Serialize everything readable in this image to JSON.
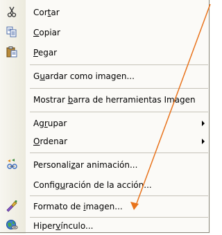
{
  "menu": {
    "items": [
      {
        "pre": "Cor",
        "u": "t",
        "post": "ar",
        "icon": "scissors-icon"
      },
      {
        "pre": "",
        "u": "C",
        "post": "opiar",
        "icon": "copy-icon"
      },
      {
        "pre": "",
        "u": "P",
        "post": "egar",
        "icon": "paste-icon"
      },
      {
        "pre": "G",
        "u": "u",
        "post": "ardar como imagen..."
      },
      {
        "pre": "Mostrar ",
        "u": "b",
        "post": "arra de herramientas Imagen"
      },
      {
        "pre": "Ag",
        "u": "r",
        "post": "upar",
        "submenu": true
      },
      {
        "pre": "",
        "u": "O",
        "post": "rdenar",
        "submenu": true
      },
      {
        "pre": "Personali",
        "u": "z",
        "post": "ar animación...",
        "icon": "animation-icon"
      },
      {
        "pre": "Config",
        "u": "u",
        "post": "ración de la acción..."
      },
      {
        "pre": "Formato de ",
        "u": "i",
        "post": "magen...",
        "icon": "format-picture-icon"
      },
      {
        "pre": "Hiper",
        "u": "v",
        "post": "ínculo...",
        "icon": "hyperlink-icon"
      }
    ]
  },
  "colors": {
    "callout_arrow": "#e8731c"
  }
}
